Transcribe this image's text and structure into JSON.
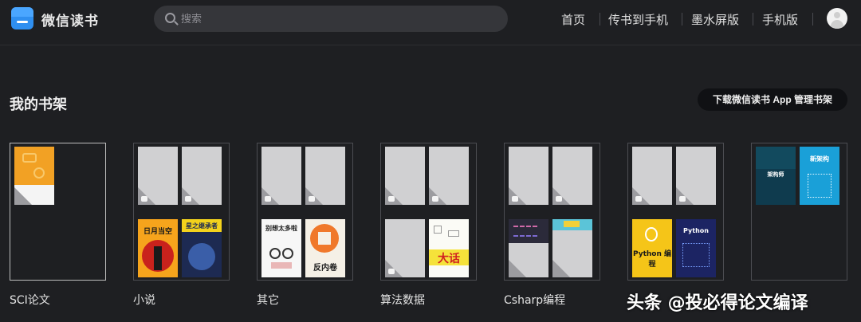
{
  "header": {
    "app_title": "微信读书",
    "search_placeholder": "搜索",
    "nav": [
      "首页",
      "传书到手机",
      "墨水屏版",
      "手机版"
    ]
  },
  "shelf": {
    "title": "我的书架",
    "download_button": "下载微信读书 App 管理书架"
  },
  "folders": [
    {
      "label": "SCI论文"
    },
    {
      "label": "小说",
      "covers": [
        "日月当空",
        "星之继承者"
      ]
    },
    {
      "label": "其它",
      "covers": [
        "别想太多啦",
        "反内卷"
      ]
    },
    {
      "label": "算法数据",
      "covers": [
        "大话"
      ]
    },
    {
      "label": "Csharp编程"
    },
    {
      "label": "",
      "covers": [
        "Python 编程",
        "Python"
      ]
    },
    {
      "label": "",
      "covers": [
        "架构师",
        "新架构"
      ]
    }
  ],
  "watermark": "头条 @投必得论文编译",
  "colors": {
    "background": "#1e1f22",
    "search_bg": "#35363a",
    "accent_logo": "#2f8ff0"
  }
}
